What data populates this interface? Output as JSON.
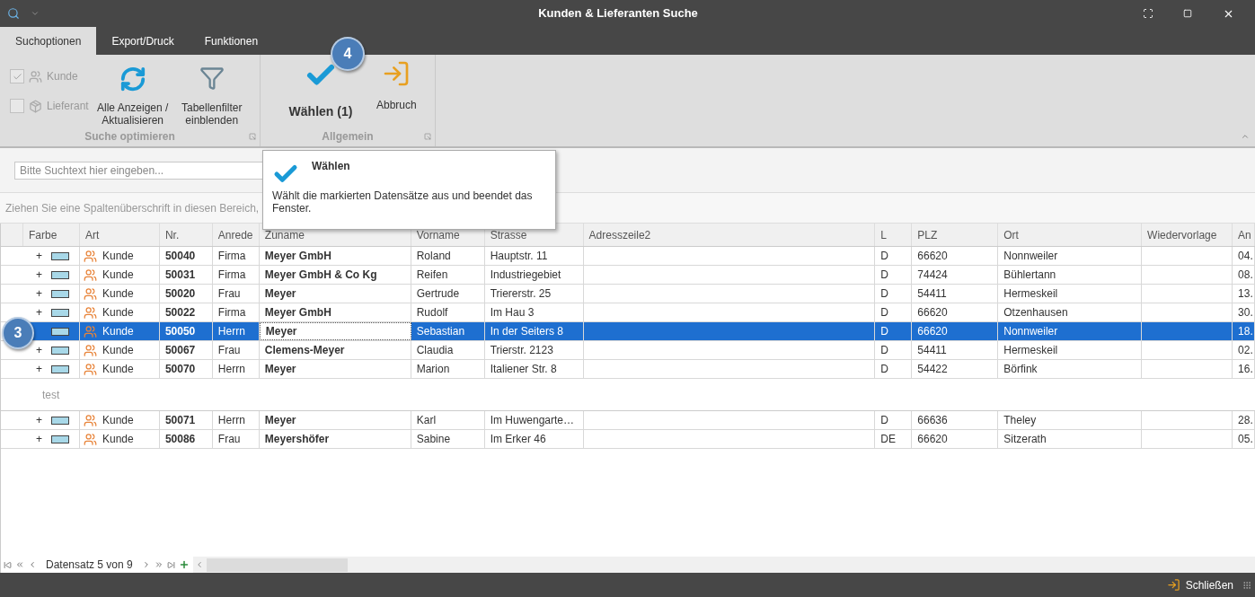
{
  "title_bar": {
    "title": "Kunden & Lieferanten Suche"
  },
  "tabs": [
    {
      "label": "Suchoptionen",
      "selected": true
    },
    {
      "label": "Export/Druck",
      "selected": false
    },
    {
      "label": "Funktionen",
      "selected": false
    }
  ],
  "ribbon": {
    "groups": [
      {
        "label": "Suche optimieren",
        "checkboxes": [
          {
            "label": "Kunde",
            "checked": true
          },
          {
            "label": "Lieferant",
            "checked": false
          }
        ],
        "buttons": [
          {
            "label": "Alle Anzeigen / Aktualisieren"
          },
          {
            "label": "Tabellenfilter einblenden"
          }
        ]
      },
      {
        "label": "Allgemein",
        "buttons": [
          {
            "label": "Wählen (1)"
          },
          {
            "label": "Abbruch"
          }
        ]
      }
    ]
  },
  "callouts": [
    {
      "label": "4"
    },
    {
      "label": "3"
    }
  ],
  "tooltip": {
    "title": "Wählen",
    "text": "Wählt die markierten Datensätze aus und beendet das Fenster."
  },
  "search": {
    "placeholder": "Bitte Suchtext hier eingeben..."
  },
  "group_panel": {
    "text": "Ziehen Sie eine Spaltenüberschrift in diesen Bereich,"
  },
  "table": {
    "columns": [
      "Farbe",
      "Art",
      "Nr.",
      "Anrede",
      "Zuname",
      "Vorname",
      "Strasse",
      "Adresszeile2",
      "L",
      "PLZ",
      "Ort",
      "Wiedervorlage",
      "An"
    ],
    "rows": [
      {
        "kind": "record",
        "selected": false,
        "expander": "+",
        "color": "#a8d8e8",
        "art": "Kunde",
        "nr": "50040",
        "anrede": "Firma",
        "zuname": "Meyer GmbH",
        "vorname": "Roland",
        "strasse": "Hauptstr. 11",
        "l": "D",
        "plz": "66620",
        "ort": "Nonnweiler",
        "column_13": "04."
      },
      {
        "kind": "record",
        "selected": false,
        "expander": "+",
        "color": "#a8d8e8",
        "art": "Kunde",
        "nr": "50031",
        "anrede": "Firma",
        "zuname": "Meyer GmbH & Co Kg",
        "vorname": "Reifen",
        "strasse": "Industriegebiet",
        "l": "D",
        "plz": "74424",
        "ort": "Bühlertann",
        "column_13": "08."
      },
      {
        "kind": "record",
        "selected": false,
        "expander": "+",
        "color": "#a8d8e8",
        "art": "Kunde",
        "nr": "50020",
        "anrede": "Frau",
        "zuname": "Meyer",
        "vorname": "Gertrude",
        "strasse": "Triererstr. 25",
        "l": "D",
        "plz": "54411",
        "ort": "Hermeskeil",
        "column_13": "13."
      },
      {
        "kind": "record",
        "selected": false,
        "expander": "+",
        "color": "#a8d8e8",
        "art": "Kunde",
        "nr": "50022",
        "anrede": "Firma",
        "zuname": "Meyer GmbH",
        "vorname": "Rudolf",
        "strasse": "Im Hau 3",
        "l": "D",
        "plz": "66620",
        "ort": "Otzenhausen",
        "column_13": "30."
      },
      {
        "kind": "record",
        "selected": true,
        "color": "#a8d8e8",
        "art": "Kunde",
        "nr": "50050",
        "anrede": "Herrn",
        "zuname": "Meyer",
        "vorname": "Sebastian",
        "strasse": "In der Seiters 8",
        "l": "D",
        "plz": "66620",
        "ort": "Nonnweiler",
        "column_13": "18."
      },
      {
        "kind": "record",
        "selected": false,
        "expander": "+",
        "color": "#a8d8e8",
        "art": "Kunde",
        "nr": "50067",
        "anrede": "Frau",
        "zuname": "Clemens-Meyer",
        "vorname": "Claudia",
        "strasse": "Trierstr. 2123",
        "l": "D",
        "plz": "54411",
        "ort": "Hermeskeil",
        "column_13": "02."
      },
      {
        "kind": "record",
        "selected": false,
        "expander": "+",
        "color": "#a8d8e8",
        "art": "Kunde",
        "nr": "50070",
        "anrede": "Herrn",
        "zuname": "Meyer",
        "vorname": "Marion",
        "strasse": "Italiener Str. 8",
        "l": "D",
        "plz": "54422",
        "ort": "Börfink",
        "column_13": "16."
      },
      {
        "kind": "group",
        "label": "test"
      },
      {
        "kind": "record",
        "selected": false,
        "expander": "+",
        "color": "#a8d8e8",
        "art": "Kunde",
        "nr": "50071",
        "anrede": "Herrn",
        "zuname": "Meyer",
        "vorname": "Karl",
        "strasse": "Im Huwengarte…",
        "l": "D",
        "plz": "66636",
        "ort": "Theley",
        "column_13": "28."
      },
      {
        "kind": "record",
        "selected": false,
        "expander": "+",
        "color": "#a8d8e8",
        "art": "Kunde",
        "nr": "50086",
        "anrede": "Frau",
        "zuname": "Meyershöfer",
        "vorname": "Sabine",
        "strasse": "Im Erker 46",
        "l": "DE",
        "plz": "66620",
        "ort": "Sitzerath",
        "column_13": "05."
      }
    ]
  },
  "navigator": {
    "text": "Datensatz 5 von 9"
  },
  "status_bar": {
    "close_label": "Schließen"
  }
}
